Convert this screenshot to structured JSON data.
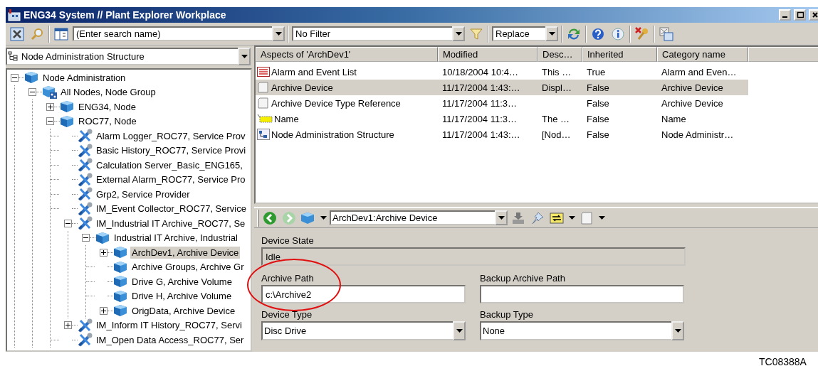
{
  "window": {
    "title": "ENG34 System // Plant Explorer Workplace"
  },
  "toolbar": {
    "search": {
      "placeholder": "(Enter search name)"
    },
    "filter": "No Filter",
    "mode": "Replace"
  },
  "structure_selector": {
    "value": "Node Administration Structure"
  },
  "tree": [
    {
      "label": "Node Administration",
      "kind": "node",
      "expanded": true,
      "selected": false,
      "children": [
        {
          "label": "All Nodes, Node Group",
          "kind": "group",
          "expanded": true,
          "selected": false,
          "children": [
            {
              "label": "ENG34, Node",
              "kind": "node",
              "expanded": false,
              "selected": false
            },
            {
              "label": "ROC77, Node",
              "kind": "node",
              "expanded": true,
              "selected": false,
              "children": [
                {
                  "label": "Alarm Logger_ROC77, Service Prov",
                  "kind": "service",
                  "selected": false
                },
                {
                  "label": "Basic History_ROC77, Service Provi",
                  "kind": "service",
                  "selected": false
                },
                {
                  "label": "Calculation Server_Basic_ENG165,",
                  "kind": "service",
                  "selected": false
                },
                {
                  "label": "External Alarm_ROC77, Service Pro",
                  "kind": "service",
                  "selected": false
                },
                {
                  "label": "Grp2, Service Provider",
                  "kind": "service",
                  "selected": false
                },
                {
                  "label": "IM_Event Collector_ROC77, Service",
                  "kind": "service",
                  "selected": false
                },
                {
                  "label": "IM_Industrial IT Archive_ROC77, Se",
                  "kind": "service",
                  "expanded": true,
                  "selected": false,
                  "children": [
                    {
                      "label": "Industrial IT Archive, Industrial",
                      "kind": "node",
                      "expanded": true,
                      "selected": false,
                      "children": [
                        {
                          "label": "ArchDev1, Archive Device",
                          "kind": "node",
                          "expanded": false,
                          "selected": true
                        },
                        {
                          "label": "Archive Groups, Archive Gr",
                          "kind": "node",
                          "selected": false
                        },
                        {
                          "label": "Drive G, Archive Volume",
                          "kind": "node",
                          "selected": false
                        },
                        {
                          "label": "Drive H, Archive Volume",
                          "kind": "node",
                          "selected": false
                        },
                        {
                          "label": "OrigData, Archive Device",
                          "kind": "node",
                          "expanded": false,
                          "selected": false
                        }
                      ]
                    }
                  ]
                },
                {
                  "label": "IM_Inform IT History_ROC77, Servi",
                  "kind": "service",
                  "expanded": false,
                  "selected": false
                },
                {
                  "label": "IM_Open Data Access_ROC77, Ser",
                  "kind": "service",
                  "selected": false
                }
              ]
            }
          ]
        }
      ]
    }
  ],
  "aspects": {
    "columns": [
      "Aspects of 'ArchDev1'",
      "Modified",
      "Desc…",
      "Inherited",
      "Category name"
    ],
    "rows": [
      {
        "kind": "list",
        "selected": false,
        "cells": [
          "Alarm and Event List",
          "10/18/2004 10:4…",
          "This …",
          "True",
          "Alarm and Even…"
        ]
      },
      {
        "kind": "page",
        "selected": true,
        "cells": [
          "Archive Device",
          "11/17/2004 1:43:…",
          "Displ…",
          "False",
          "Archive Device"
        ]
      },
      {
        "kind": "page",
        "selected": false,
        "cells": [
          "Archive Device Type Reference",
          "11/17/2004 11:3…",
          null,
          "False",
          "Archive Device"
        ]
      },
      {
        "kind": "tag",
        "selected": false,
        "cells": [
          "Name",
          "11/17/2004 11:3…",
          "The …",
          "False",
          "Name"
        ]
      },
      {
        "kind": "structure",
        "selected": false,
        "cells": [
          "Node Administration Structure",
          "11/17/2004 1:43:…",
          "[Nod…",
          "False",
          "Node Administr…"
        ]
      }
    ]
  },
  "aspect_toolbar": {
    "address": "ArchDev1:Archive Device"
  },
  "form": {
    "fields": [
      {
        "label": "Device State",
        "kind": "readonly",
        "value": "Idle"
      },
      {
        "label": "Archive Path",
        "kind": "text",
        "value": "c:\\Archive2"
      },
      {
        "label": "Backup Archive Path",
        "kind": "text"
      },
      {
        "label": "Device Type",
        "kind": "dropdown",
        "value": "Disc Drive"
      },
      {
        "label": "Backup Type",
        "kind": "dropdown",
        "value": "None"
      }
    ]
  },
  "caption": "TC08388A"
}
